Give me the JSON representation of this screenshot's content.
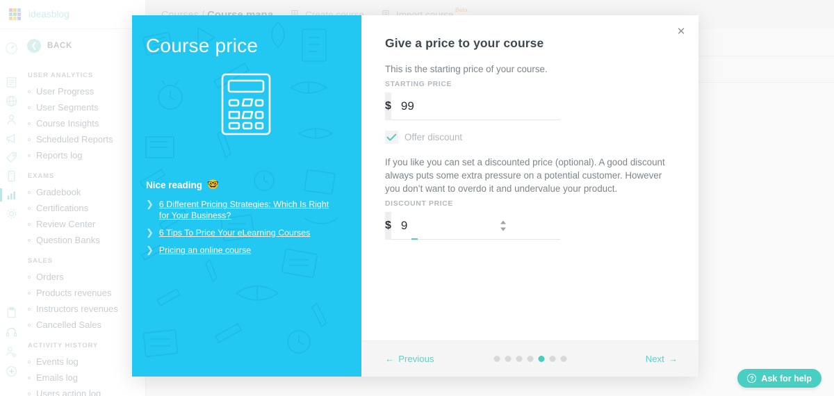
{
  "app": {
    "logo_text": "ideasblog",
    "logo_colors": [
      "#f6c6c6",
      "#f3dfae",
      "#bfe3f2",
      "#bfe7dd",
      "#cfe3c3",
      "#d7d3ea",
      "#f7d9b0",
      "#f1e7b6",
      "#c6d3ef"
    ]
  },
  "background": {
    "breadcrumb_prefix": "Courses / ",
    "breadcrumb_current": "Course mana",
    "create_course": "Create course",
    "import_course": "Import course",
    "import_beta": "Beta"
  },
  "sidebar": {
    "back_label": "BACK",
    "groups": [
      {
        "title": "USER ANALYTICS",
        "items": [
          {
            "label": "User Progress"
          },
          {
            "label": "User Segments"
          },
          {
            "label": "Course Insights"
          },
          {
            "label": "Scheduled Reports"
          },
          {
            "label": "Reports log"
          }
        ]
      },
      {
        "title": "EXAMS",
        "items": [
          {
            "label": "Gradebook"
          },
          {
            "label": "Certifications"
          },
          {
            "label": "Review Center"
          },
          {
            "label": "Question Banks"
          }
        ]
      },
      {
        "title": "SALES",
        "items": [
          {
            "label": "Orders"
          },
          {
            "label": "Products revenues"
          },
          {
            "label": "Instructors revenues"
          },
          {
            "label": "Cancelled Sales"
          }
        ]
      },
      {
        "title": "ACTIVITY HISTORY",
        "items": [
          {
            "label": "Events log"
          },
          {
            "label": "Emails log"
          },
          {
            "label": "Users action log"
          }
        ]
      }
    ],
    "rail_icons": [
      {
        "name": "gauge-icon"
      },
      {
        "name": "document-icon"
      },
      {
        "name": "globe-icon"
      },
      {
        "name": "user-icon"
      },
      {
        "name": "megaphone-icon"
      },
      {
        "name": "tag-icon"
      },
      {
        "name": "mobile-icon"
      },
      {
        "name": "chart-icon",
        "active": true
      },
      {
        "name": "gear-icon"
      },
      {
        "name": "clipboard-icon"
      },
      {
        "name": "headset-icon"
      },
      {
        "name": "user-add-icon"
      },
      {
        "name": "plus-circle-icon"
      }
    ]
  },
  "modal": {
    "left": {
      "title": "Course price",
      "illustration": "calculator-icon",
      "nice_reading": "Nice reading",
      "nice_reading_emoji": "🤓",
      "links": [
        {
          "text": "6 Different Pricing Strategies: Which Is Right for Your Business?"
        },
        {
          "text": "6 Tips To Price Your eLearning Courses"
        },
        {
          "text": "Pricing an online course"
        }
      ]
    },
    "right": {
      "close_label": "✕",
      "heading": "Give a price to your course",
      "intro": "This is the starting price of your course.",
      "starting_price_label": "STARTING PRICE",
      "currency_symbol": "$",
      "starting_price_value": "99",
      "offer_discount_label": "Offer discount",
      "offer_discount_checked": true,
      "discount_intro": "If you like you can set a discounted price (optional). A good discount always puts some extra pressure on a potential customer. However you don’t want to overdo it and undervalue your product.",
      "discount_price_label": "DISCOUNT PRICE",
      "discount_currency_symbol": "$",
      "discount_price_value": "9"
    },
    "footer": {
      "previous_label": "Previous",
      "next_label": "Next",
      "steps_total": 7,
      "step_active": 5
    }
  },
  "help": {
    "label": "Ask for help",
    "icon": "question-circle-icon"
  },
  "colors": {
    "panel_cyan": "#22c7f2",
    "accent_teal": "#43cfc0",
    "text_dark": "#3f4750",
    "text_muted": "#7d858c"
  }
}
